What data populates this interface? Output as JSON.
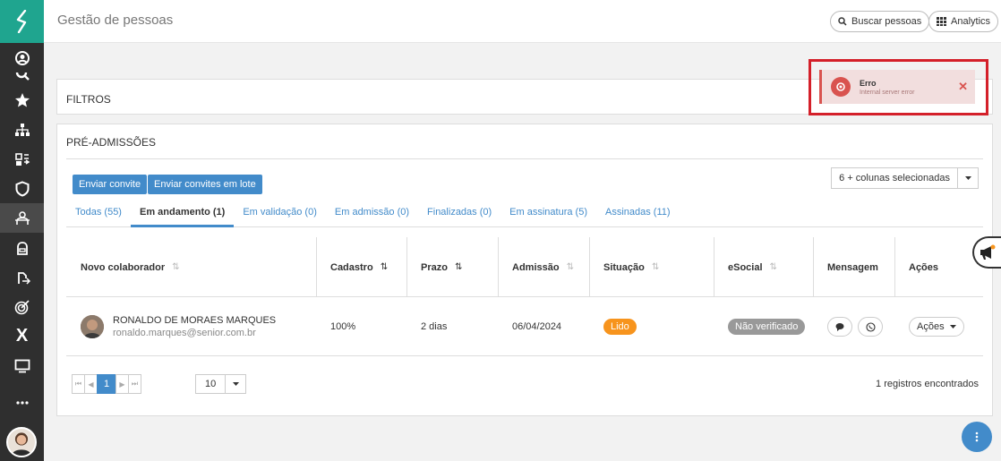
{
  "header": {
    "title": "Gestão de pessoas",
    "search_btn": "Buscar pessoas",
    "analytics_btn": "Analytics"
  },
  "filters": {
    "title": "FILTROS"
  },
  "section": {
    "title": "PRÉ-ADMISSÕES",
    "invite_btn": "Enviar convite",
    "bulk_invite_btn": "Enviar convites em lote",
    "columns_select": "6 + colunas selecionadas"
  },
  "tabs": [
    {
      "label": "Todas (55)"
    },
    {
      "label": "Em andamento (1)"
    },
    {
      "label": "Em validação (0)"
    },
    {
      "label": "Em admissão (0)"
    },
    {
      "label": "Finalizadas (0)"
    },
    {
      "label": "Em assinatura (5)"
    },
    {
      "label": "Assinadas (11)"
    }
  ],
  "table": {
    "headers": [
      "Novo colaborador",
      "Cadastro",
      "Prazo",
      "Admissão",
      "Situação",
      "eSocial",
      "Mensagem",
      "Ações"
    ],
    "rows": [
      {
        "name": "RONALDO DE MORAES MARQUES",
        "email": "ronaldo.marques@senior.com.br",
        "cadastro": "100%",
        "prazo": "2 dias",
        "admissao": "06/04/2024",
        "situacao": "Lido",
        "esocial": "Não verificado",
        "acoes": "Ações"
      }
    ]
  },
  "pagination": {
    "current_page": "1",
    "page_size": "10",
    "records": "1 registros encontrados"
  },
  "toast": {
    "title": "Erro",
    "message": "Internal server error"
  },
  "colors": {
    "sidebar": "#2f2f2f",
    "logo": "#1fa58f",
    "primary": "#428bca",
    "error": "#d9534f",
    "badge_lido": "#f7941d"
  }
}
